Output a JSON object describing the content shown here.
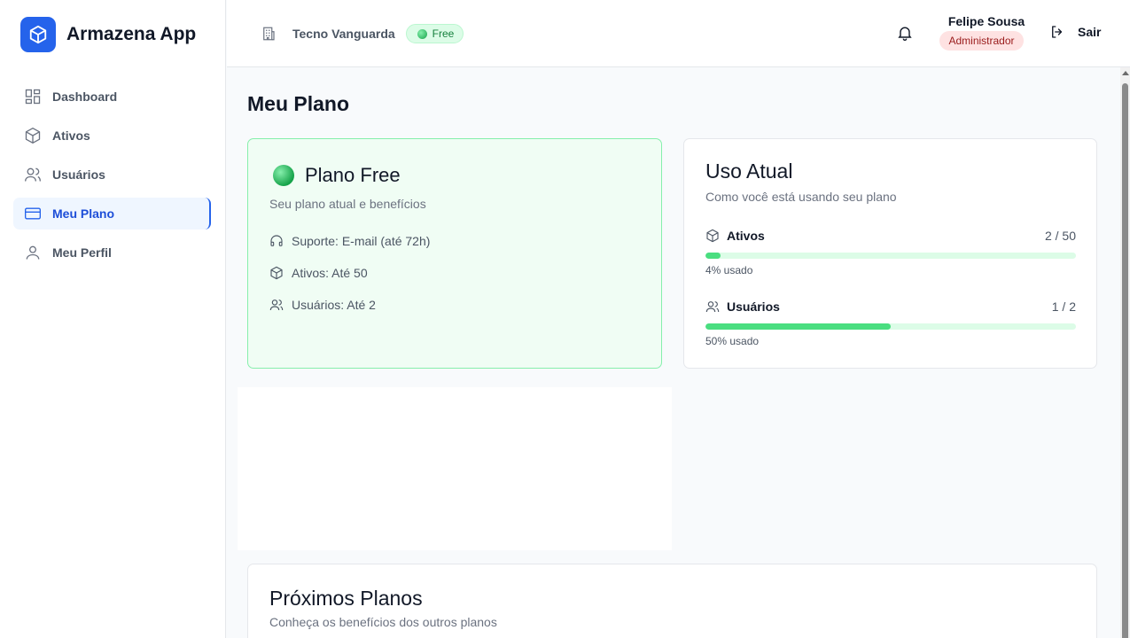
{
  "app": {
    "name": "Armazena App",
    "logo_icon": "cube-icon",
    "accent": "#2563eb"
  },
  "sidebar": {
    "items": [
      {
        "label": "Dashboard",
        "icon": "dashboard-grid-icon",
        "active": false
      },
      {
        "label": "Ativos",
        "icon": "cube-icon",
        "active": false
      },
      {
        "label": "Usuários",
        "icon": "users-icon",
        "active": false
      },
      {
        "label": "Meu Plano",
        "icon": "credit-card-icon",
        "active": true
      },
      {
        "label": "Meu Perfil",
        "icon": "user-icon",
        "active": false
      }
    ]
  },
  "header": {
    "company_name": "Tecno Vanguarda",
    "company_icon": "building-icon",
    "plan_badge": "Free",
    "notification_icon": "bell-icon",
    "user_name": "Felipe Sousa",
    "user_role": "Administrador",
    "logout_label": "Sair",
    "logout_icon": "logout-icon"
  },
  "main": {
    "page_title": "Meu Plano",
    "plan_card": {
      "title": "Plano Free",
      "subtitle": "Seu plano atual e benefícios",
      "features": [
        {
          "icon": "headphones-icon",
          "text": "Suporte: E-mail (até 72h)"
        },
        {
          "icon": "cube-icon",
          "text": "Ativos: Até 50"
        },
        {
          "icon": "users-icon",
          "text": "Usuários: Até 2"
        }
      ]
    },
    "usage_card": {
      "title": "Uso Atual",
      "subtitle": "Como você está usando seu plano",
      "metrics": [
        {
          "icon": "cube-icon",
          "label": "Ativos",
          "value": "2 / 50",
          "fraction": 0.04,
          "note": "4% usado"
        },
        {
          "icon": "users-icon",
          "label": "Usuários",
          "value": "1 / 2",
          "fraction": 0.5,
          "note": "50% usado"
        }
      ]
    },
    "next_plans": {
      "title": "Próximos Planos",
      "subtitle": "Conheça os benefícios dos outros planos"
    }
  },
  "colors": {
    "plan_green": "#16a34a",
    "bar_fill": "#4ade80",
    "bar_track": "#dcfce7",
    "role_badge_bg": "#fee2e2"
  }
}
